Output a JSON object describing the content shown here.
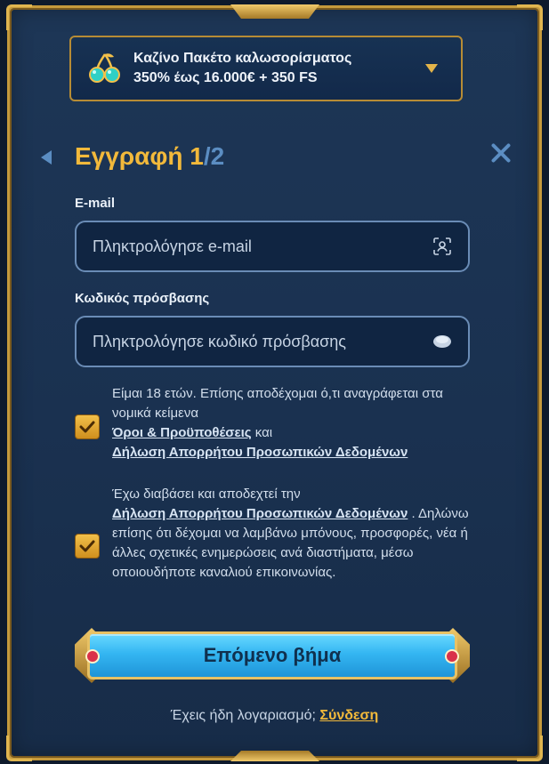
{
  "bonus": {
    "title": "Καζίνο Πακέτο καλωσορίσματος",
    "subtitle": "350% έως 16.000€ + 350 FS",
    "icon": "cherries-icon"
  },
  "header": {
    "title": "Εγγραφή",
    "step_current": "1",
    "step_total": "/2"
  },
  "email": {
    "label": "E-mail",
    "placeholder": "Πληκτρολόγησε e-mail",
    "icon": "user-scan-icon"
  },
  "password": {
    "label": "Κωδικός πρόσβασης",
    "placeholder": "Πληκτρολόγησε κωδικό πρόσβασης",
    "icon": "eye-icon"
  },
  "consent_age": {
    "checked": true,
    "text_1": "Είμαι 18 ετών. Επίσης αποδέχομαι ό,τι αναγράφεται στα νομικά κείμενα",
    "link_terms": "Όροι & Προϋποθέσεις",
    "text_and": " και",
    "link_privacy": "Δήλωση Απορρήτου Προσωπικών Δεδομένων"
  },
  "consent_marketing": {
    "checked": true,
    "text_1": "Έχω διαβάσει και αποδεχτεί την",
    "link_privacy": "Δήλωση Απορρήτου Προσωπικών Δεδομένων",
    "text_2": " . Δηλώνω επίσης ότι δέχομαι να λαμβάνω μπόνους, προσφορές, νέα ή άλλες σχετικές ενημερώσεις ανά διαστήματα, μέσω οποιουδήποτε καναλιού επικοινωνίας."
  },
  "next_button": {
    "label": "Επόμενο βήμα"
  },
  "footer": {
    "question": "Έχεις ήδη λογαριασμό; ",
    "login_link": "Σύνδεση"
  }
}
